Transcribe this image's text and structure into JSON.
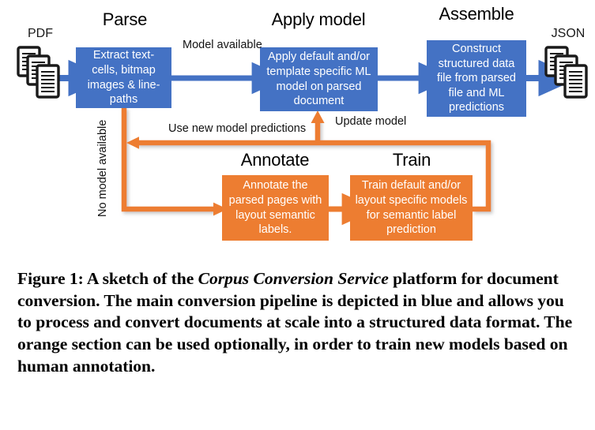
{
  "figure": {
    "stages": [
      {
        "id": "parse",
        "title": "Parse"
      },
      {
        "id": "apply-model",
        "title": "Apply model"
      },
      {
        "id": "assemble",
        "title": "Assemble"
      },
      {
        "id": "annotate",
        "title": "Annotate"
      },
      {
        "id": "train",
        "title": "Train"
      }
    ],
    "io": {
      "input_label": "PDF",
      "output_label": "JSON",
      "input_icon": "document-stack-icon",
      "output_icon": "document-stack-icon"
    },
    "nodes": {
      "parse": "Extract text-cells, bitmap images & line-paths",
      "apply_model": "Apply default and/or template specific ML model on parsed document",
      "assemble": "Construct structured data file from parsed file and ML predictions",
      "annotate": "Annotate the parsed pages with layout semantic labels.",
      "train": "Train default and/or layout specific models for semantic label prediction"
    },
    "edges": {
      "model_available": "Model available",
      "no_model_available": "No model available",
      "use_new_model_predictions": "Use new model predictions",
      "update_model": "Update model"
    },
    "colors": {
      "blue": "#4472C4",
      "orange": "#ED7D31",
      "text": "#000000",
      "background": "#FFFFFF"
    }
  },
  "caption": {
    "label": "Figure 1:",
    "text_before_italic": "  A sketch of the ",
    "italic": "Corpus Conversion Service",
    "text_after_italic": " platform for document conversion. The main conversion pipeline is depicted in blue and allows you to process and convert documents at scale into a structured data format. The orange section can be used optionally, in order to train new models based on human annotation."
  }
}
